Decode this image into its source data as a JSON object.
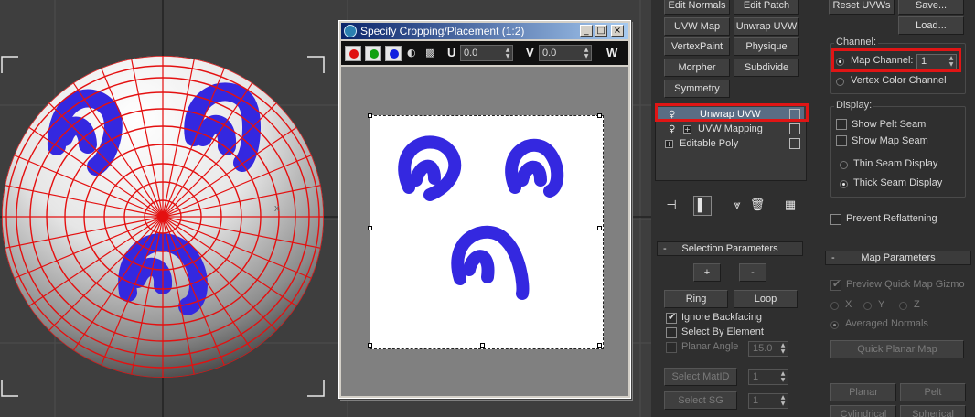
{
  "dialog": {
    "title": "Specify Cropping/Placement (1:2)",
    "minimize": "_",
    "maximize": "□",
    "close": "×",
    "u_label": "U",
    "u_value": "0.0",
    "v_label": "V",
    "v_value": "0.0",
    "w_label": "W",
    "colors": {
      "red": "#e01010",
      "green": "#10a010",
      "blue": "#1020e0"
    }
  },
  "modifier_buttons": [
    "Edit Normals",
    "Edit Patch",
    "UVW Map",
    "Unwrap UVW",
    "VertexPaint",
    "Physique",
    "Morpher",
    "Subdivide",
    "Symmetry"
  ],
  "stack": {
    "items": [
      {
        "label": "Unwrap UVW"
      },
      {
        "label": "UVW Mapping"
      },
      {
        "label": "Editable Poly"
      }
    ]
  },
  "stack_toolbar_icons": [
    "pin-stack-icon",
    "show-end-result-icon",
    "make-unique-icon",
    "remove-modifier-icon",
    "configure-modifier-sets-icon"
  ],
  "right_column": {
    "reset_uvws": "Reset UVWs",
    "save": "Save...",
    "load": "Load...",
    "channel_group": "Channel:",
    "map_channel_label": "Map Channel:",
    "map_channel_value": "1",
    "vertex_color_channel": "Vertex Color Channel",
    "display_group": "Display:",
    "show_pelt_seam": "Show Pelt Seam",
    "show_map_seam": "Show Map Seam",
    "thin_seam": "Thin Seam Display",
    "thick_seam": "Thick Seam Display",
    "prevent_reflattening": "Prevent Reflattening",
    "map_params_title": "Map Parameters",
    "preview_quick_map_gizmo": "Preview Quick Map Gizmo",
    "axis_x": "X",
    "axis_y": "Y",
    "axis_z": "Z",
    "averaged_normals": "Averaged Normals",
    "quick_planar_map": "Quick Planar Map",
    "planar": "Planar",
    "pelt": "Pelt",
    "cylindrical": "Cylindrical",
    "spherical": "Spherical"
  },
  "selection_params": {
    "title": "Selection Parameters",
    "plus": "+",
    "minus": "-",
    "ring": "Ring",
    "loop": "Loop",
    "ignore_backfacing": "Ignore Backfacing",
    "select_by_element": "Select By Element",
    "planar_angle": "Planar Angle",
    "planar_angle_value": "15.0",
    "select_matid": "Select MatID",
    "select_matid_value": "1",
    "select_sg": "Select SG",
    "select_sg_value": "1"
  },
  "rollout_minus": "-"
}
